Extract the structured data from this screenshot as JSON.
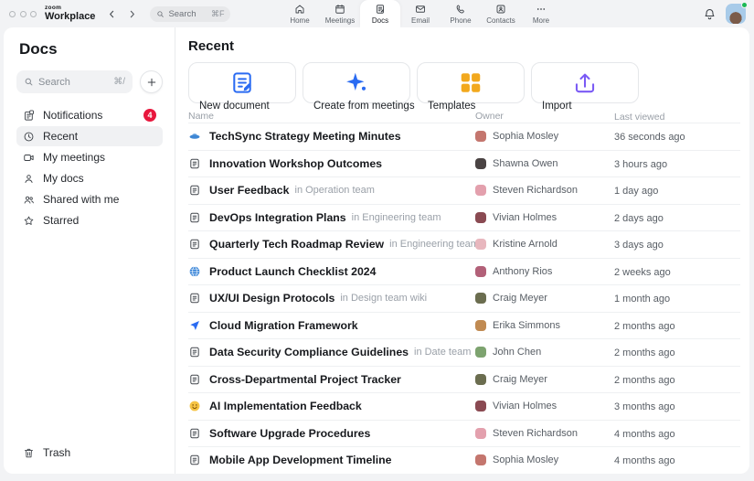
{
  "topbar": {
    "logo": {
      "brand": "zoom",
      "product": "Workplace"
    },
    "search": {
      "placeholder": "Search",
      "shortcut": "⌘F"
    },
    "tabs": [
      {
        "id": "home",
        "label": "Home",
        "icon": "home",
        "active": false
      },
      {
        "id": "meetings",
        "label": "Meetings",
        "icon": "calendar",
        "active": false
      },
      {
        "id": "docs",
        "label": "Docs",
        "icon": "docs",
        "active": true
      },
      {
        "id": "email",
        "label": "Email",
        "icon": "mail",
        "active": false
      },
      {
        "id": "phone",
        "label": "Phone",
        "icon": "phone",
        "active": false
      },
      {
        "id": "contacts",
        "label": "Contacts",
        "icon": "contacts",
        "active": false
      },
      {
        "id": "more",
        "label": "More",
        "icon": "more",
        "active": false
      }
    ],
    "presence_color": "#1cb955"
  },
  "sidebar": {
    "title": "Docs",
    "search": {
      "placeholder": "Search",
      "shortcut": "⌘/"
    },
    "items": [
      {
        "id": "notifications",
        "label": "Notifications",
        "icon": "doc-badge",
        "badge": "4",
        "active": false
      },
      {
        "id": "recent",
        "label": "Recent",
        "icon": "clock",
        "active": true
      },
      {
        "id": "my-meetings",
        "label": "My meetings",
        "icon": "video",
        "active": false
      },
      {
        "id": "my-docs",
        "label": "My docs",
        "icon": "person",
        "active": false
      },
      {
        "id": "shared-with-me",
        "label": "Shared with me",
        "icon": "people",
        "active": false
      },
      {
        "id": "starred",
        "label": "Starred",
        "icon": "star",
        "active": false
      }
    ],
    "trash_label": "Trash",
    "badge_color": "#e8173d"
  },
  "main": {
    "title": "Recent",
    "cards": [
      {
        "id": "new-document",
        "label": "New document",
        "icon": "new-doc",
        "color": "#2a6bf2"
      },
      {
        "id": "create-from-meetings",
        "label": "Create from meetings",
        "icon": "sparkle",
        "color": "#2a6bf2"
      },
      {
        "id": "templates",
        "label": "Templates",
        "icon": "grid",
        "color": "#f2a81d"
      },
      {
        "id": "import",
        "label": "Import",
        "icon": "import",
        "color": "#7a5af5"
      }
    ],
    "table": {
      "columns": [
        "Name",
        "Owner",
        "Last viewed"
      ],
      "star_color": "#f2b11b",
      "rows": [
        {
          "icon": "saucer",
          "title": "TechSync Strategy Meeting Minutes",
          "owner": "Sophia Mosley",
          "owner_color": "#c4766e",
          "last_viewed": "36 seconds ago"
        },
        {
          "icon": "doc",
          "title": "Innovation Workshop Outcomes",
          "owner": "Shawna Owen",
          "owner_color": "#4a4343",
          "last_viewed": "3 hours ago"
        },
        {
          "icon": "doc",
          "title": "User Feedback",
          "suffix": "in Operation team",
          "owner": "Steven Richardson",
          "owner_color": "#e3a0ad",
          "last_viewed": "1 day ago"
        },
        {
          "icon": "doc",
          "title": "DevOps Integration Plans",
          "suffix": "in Engineering team",
          "owner": "Vivian Holmes",
          "owner_color": "#8a4a52",
          "last_viewed": "2 days ago"
        },
        {
          "icon": "doc",
          "title": "Quarterly Tech Roadmap Review",
          "suffix": "in Engineering team",
          "owner": "Kristine Arnold",
          "owner_color": "#e8b7be",
          "last_viewed": "3 days ago"
        },
        {
          "icon": "globe",
          "title": "Product Launch Checklist 2024",
          "owner": "Anthony Rios",
          "owner_color": "#b26078",
          "last_viewed": "2 weeks ago"
        },
        {
          "icon": "doc",
          "title": "UX/UI Design Protocols",
          "suffix": "in Design team wiki",
          "owner": "Craig Meyer",
          "owner_color": "#6b6d4f",
          "last_viewed": "1 month ago"
        },
        {
          "icon": "send",
          "title": "Cloud Migration Framework",
          "owner": "Erika Simmons",
          "owner_color": "#c08a52",
          "last_viewed": "2 months ago"
        },
        {
          "icon": "doc",
          "title": "Data Security Compliance Guidelines",
          "suffix": "in Date team",
          "starred": true,
          "owner": "John Chen",
          "owner_color": "#7da36f",
          "last_viewed": "2 months ago"
        },
        {
          "icon": "doc",
          "title": "Cross-Departmental Project Tracker",
          "owner": "Craig Meyer",
          "owner_color": "#6b6d4f",
          "last_viewed": "2 months ago"
        },
        {
          "icon": "smiley",
          "title": "AI Implementation Feedback",
          "owner": "Vivian Holmes",
          "owner_color": "#8a4a52",
          "last_viewed": "3 months ago"
        },
        {
          "icon": "doc",
          "title": "Software Upgrade Procedures",
          "owner": "Steven Richardson",
          "owner_color": "#e3a0ad",
          "last_viewed": "4 months ago"
        },
        {
          "icon": "doc",
          "title": "Mobile App Development Timeline",
          "owner": "Sophia Mosley",
          "owner_color": "#c4766e",
          "last_viewed": "4 months ago"
        }
      ]
    }
  }
}
